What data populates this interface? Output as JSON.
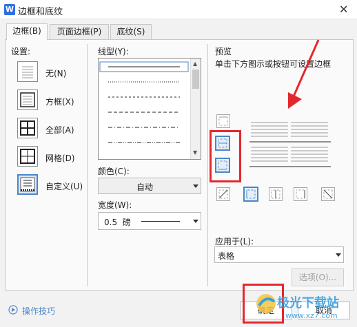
{
  "window": {
    "title": "边框和底纹",
    "app_icon_letter": "W"
  },
  "tabs": [
    {
      "label": "边框(B)",
      "active": true
    },
    {
      "label": "页面边框(P)",
      "active": false
    },
    {
      "label": "底纹(S)",
      "active": false
    }
  ],
  "settings": {
    "heading": "设置:",
    "items": [
      {
        "label": "无(N)",
        "icon": "none-border-icon"
      },
      {
        "label": "方框(X)",
        "icon": "box-border-icon"
      },
      {
        "label": "全部(A)",
        "icon": "all-border-icon"
      },
      {
        "label": "网格(D)",
        "icon": "grid-border-icon"
      },
      {
        "label": "自定义(U)",
        "icon": "custom-border-icon",
        "selected": true
      }
    ]
  },
  "style": {
    "line_type_label": "线型(Y):",
    "line_types": [
      "solid",
      "dotted",
      "dash-small",
      "dash",
      "dash-dot",
      "dash-dot-dot"
    ],
    "color_label": "颜色(C):",
    "color_value": "自动",
    "width_label": "宽度(W):",
    "width_value": "0.5  磅"
  },
  "preview": {
    "heading": "预览",
    "hint": "单击下方图示或按钮可设置边框",
    "apply_to_label": "应用于(L):",
    "apply_to_value": "表格",
    "options_button": "选项(O)..."
  },
  "footer": {
    "tips_label": "操作技巧",
    "ok_button": "确定",
    "cancel_button": "取消"
  },
  "watermark": {
    "text": "极光下载站",
    "url_text": "www.xz7.com"
  },
  "colors": {
    "accent": "#4a86c8",
    "annotation_red": "#e3282d"
  }
}
